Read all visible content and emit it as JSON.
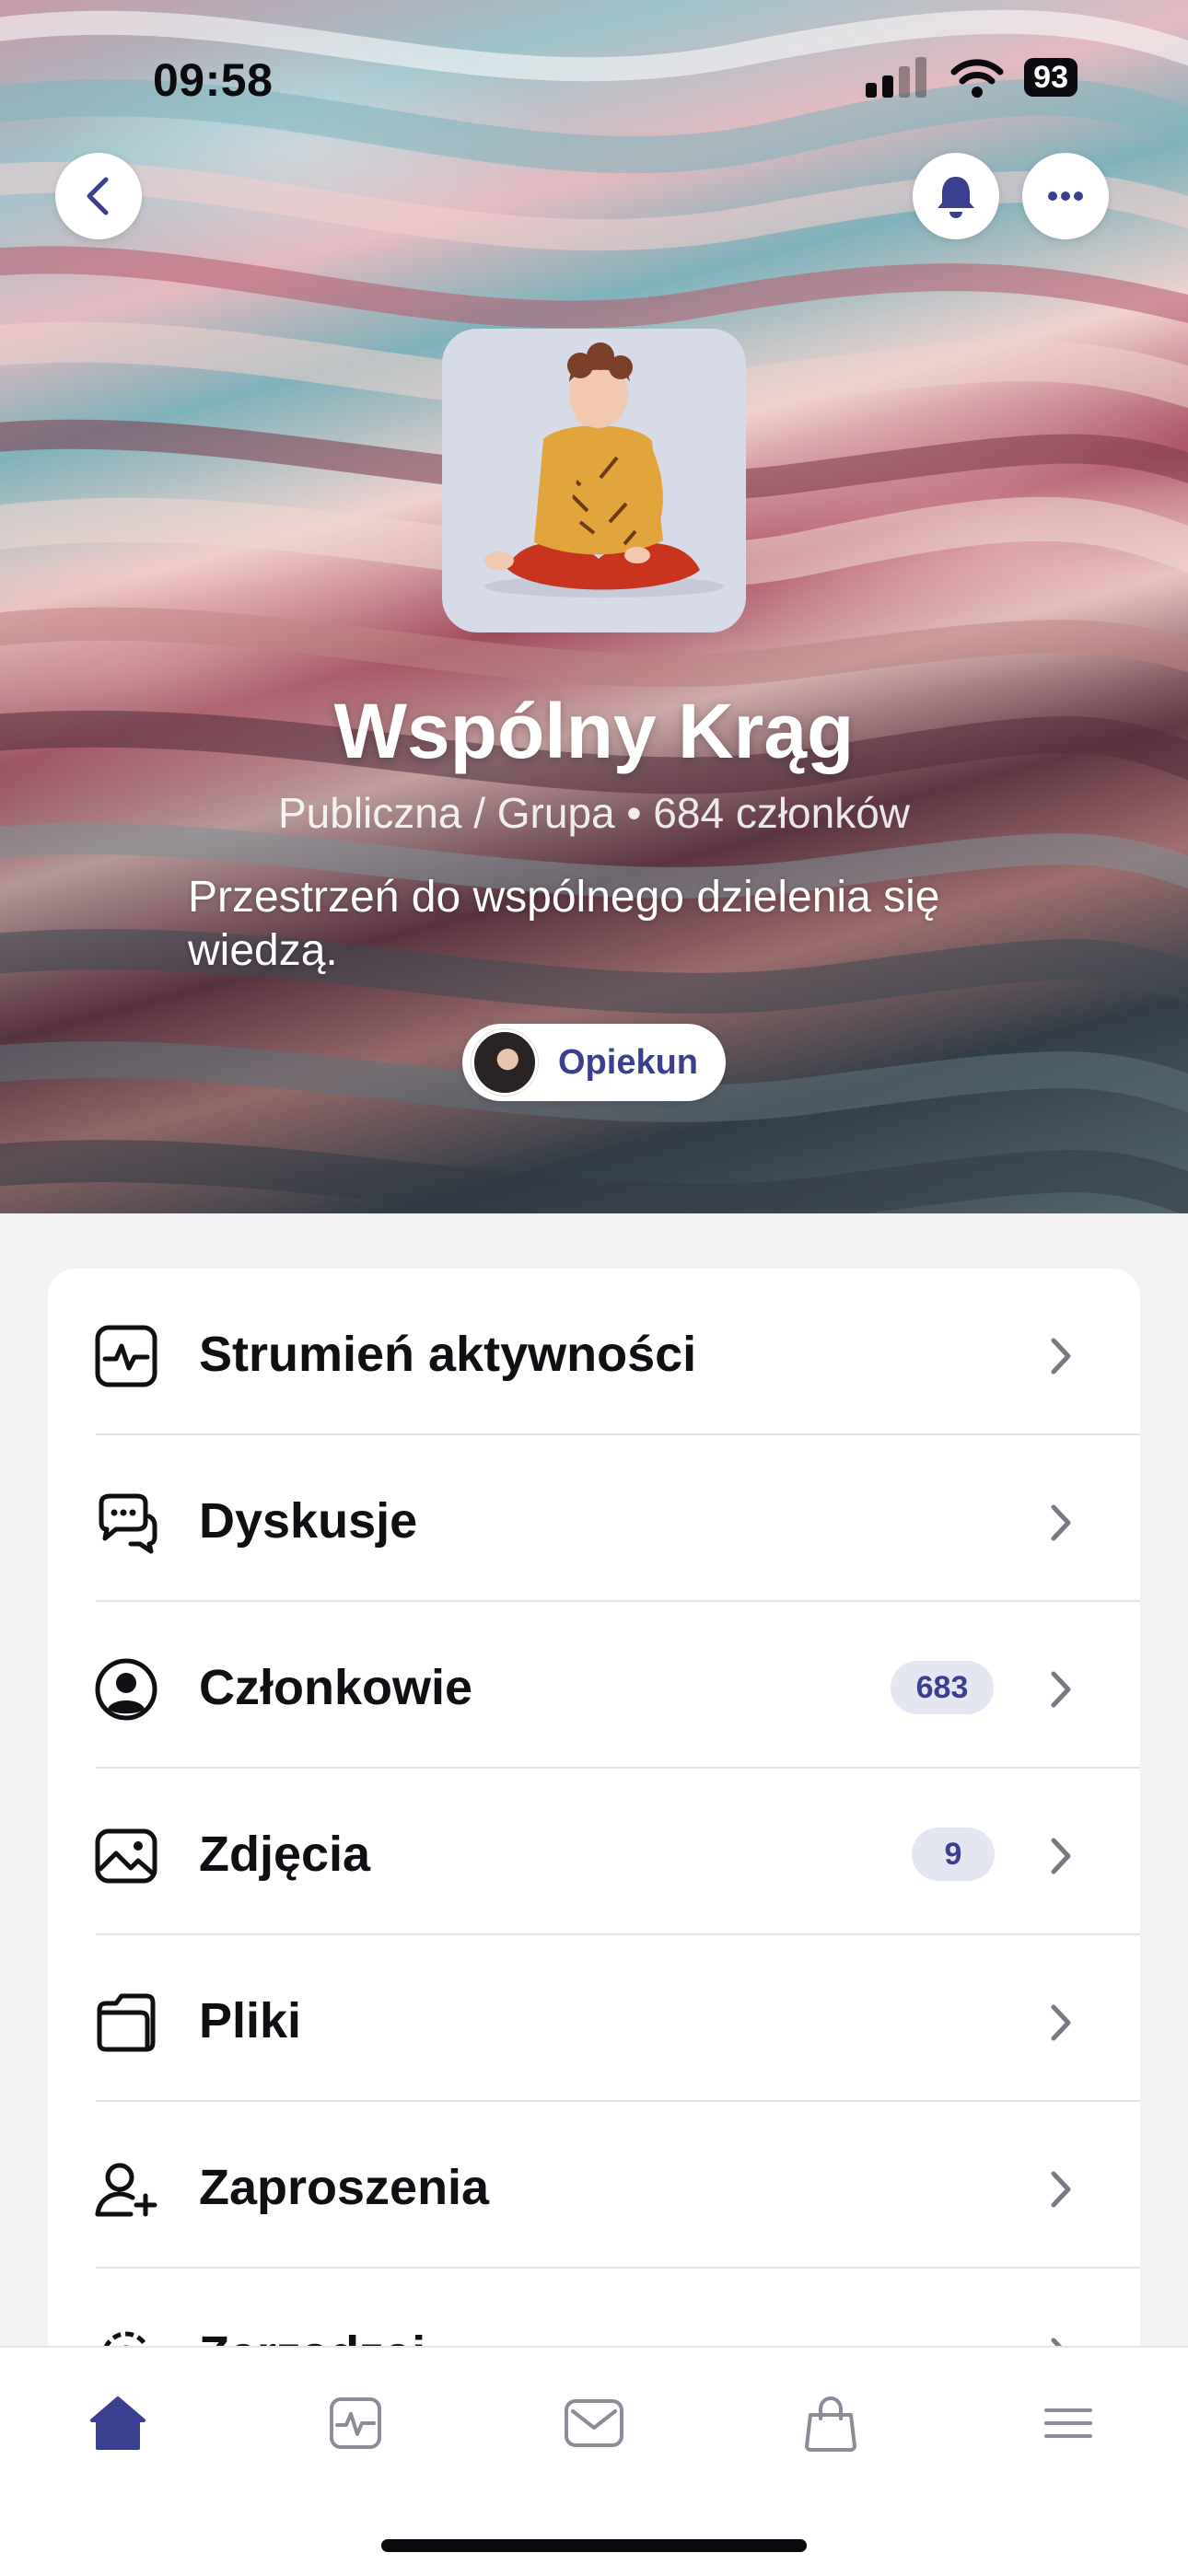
{
  "status_bar": {
    "time": "09:58",
    "battery": "93"
  },
  "group": {
    "name": "Wspólny Krąg",
    "meta": "Publiczna / Grupa • 684 członków",
    "description": "Przestrzeń do wspólnego dzielenia się wiedzą.",
    "role_label": "Opiekun"
  },
  "menu": {
    "items": [
      {
        "label": "Strumień aktywności",
        "icon": "activity-icon",
        "badge": ""
      },
      {
        "label": "Dyskusje",
        "icon": "discussion-icon",
        "badge": ""
      },
      {
        "label": "Członkowie",
        "icon": "member-icon",
        "badge": "683"
      },
      {
        "label": "Zdjęcia",
        "icon": "photo-icon",
        "badge": "9"
      },
      {
        "label": "Pliki",
        "icon": "folder-icon",
        "badge": ""
      },
      {
        "label": "Zaproszenia",
        "icon": "invite-icon",
        "badge": ""
      },
      {
        "label": "Zarządzaj",
        "icon": "settings-icon",
        "badge": ""
      }
    ]
  },
  "tabbar": {
    "tabs": [
      {
        "icon": "home-icon",
        "active": true
      },
      {
        "icon": "activity-icon",
        "active": false
      },
      {
        "icon": "mail-icon",
        "active": false
      },
      {
        "icon": "shop-bag-icon",
        "active": false
      },
      {
        "icon": "menu-icon",
        "active": false
      }
    ]
  },
  "colors": {
    "accent": "#3b3f8f",
    "badge_bg": "#e4e7f2",
    "tab_inactive": "#8c8c98"
  }
}
